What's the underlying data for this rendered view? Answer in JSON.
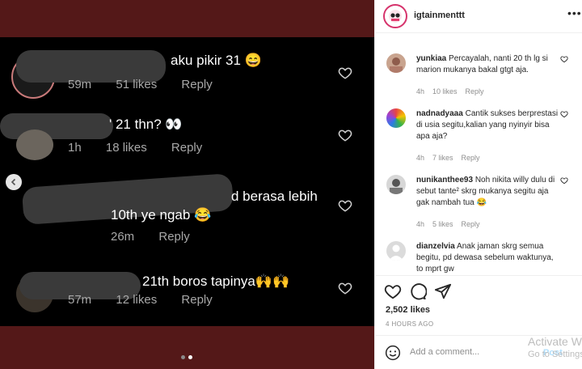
{
  "media": {
    "comments": [
      {
        "text": "aku pikir 31 😄",
        "time": "59m",
        "likes": "51 likes",
        "reply": "Reply"
      },
      {
        "text": "' 21 thn? 👀",
        "time": "1h",
        "likes": "18 likes",
        "reply": "Reply"
      },
      {
        "text": "d berasa lebih",
        "text2": "10th ye ngab 😂",
        "time": "26m",
        "likes": "",
        "reply": "Reply"
      },
      {
        "text": "21th boros tapinya🙌🙌",
        "time": "57m",
        "likes": "12 likes",
        "reply": "Reply"
      }
    ]
  },
  "panel": {
    "username": "igtainmenttt",
    "more": "•••",
    "comments": [
      {
        "user": "yunkiaa",
        "text": "Percayalah, nanti 20 th lg si marion mukanya bakal gtgt aja.",
        "time": "4h",
        "likes": "10 likes",
        "reply": "Reply"
      },
      {
        "user": "nadnadyaaa",
        "text": "Cantik sukses berprestasi di usia segitu,kalian yang nyinyir bisa apa aja?",
        "time": "4h",
        "likes": "7 likes",
        "reply": "Reply"
      },
      {
        "user": "nunikanthee93",
        "text": "Noh nikita willy dulu di sebut tante² skrg mukanya segitu aja gak nambah tua 😂",
        "time": "4h",
        "likes": "5 likes",
        "reply": "Reply"
      },
      {
        "user": "dianzelvia",
        "text": "Anak jaman skrg semua begitu, pd dewasa sebelum waktunya, to mprt gw",
        "time": "",
        "likes": "",
        "reply": ""
      }
    ],
    "likes": "2,502 likes",
    "posted": "4 HOURS AGO",
    "add_comment_placeholder": "Add a comment...",
    "post_label": "Post"
  },
  "watermark": {
    "line1": "Activate W",
    "line2": "Go to Settings"
  },
  "colors": {
    "media_bg": "#541818",
    "shot_bg": "#000000",
    "link_blue": "#b2dffc"
  }
}
